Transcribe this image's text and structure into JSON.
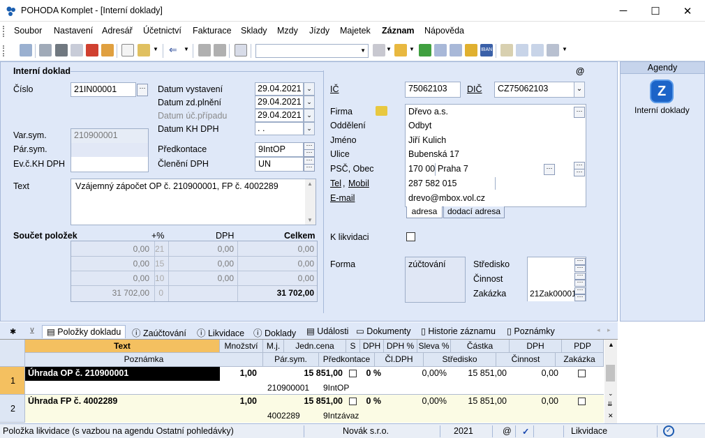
{
  "window": {
    "title": "POHODA Komplet - [Interní doklady]",
    "minimize": "─",
    "maximize": "☐",
    "close": "✕"
  },
  "menu": [
    "Soubor",
    "Nastavení",
    "Adresář",
    "Účetnictví",
    "Fakturace",
    "Sklady",
    "Mzdy",
    "Jízdy",
    "Majetek",
    "Záznam",
    "Nápověda"
  ],
  "form": {
    "section_title": "Interní doklad",
    "at_sign": "@",
    "cislo_label": "Číslo",
    "cislo_value": "21IN00001",
    "datum_vystaveni_label": "Datum vystavení",
    "datum_vystaveni": "29.04.2021",
    "datum_zdplneni_label": "Datum zd.plnění",
    "datum_zdplneni": "29.04.2021",
    "datum_ucprip_label": "Datum úč.případu",
    "datum_ucprip": "29.04.2021",
    "datum_khdph_label": "Datum KH DPH",
    "datum_khdph": "  .  .",
    "varsym_label": "Var.sym.",
    "varsym": "210900001",
    "parsym_label": "Pár.sym.",
    "evckh_label": "Ev.č.KH DPH",
    "predkontace_label": "Předkontace",
    "predkontace": "9IntOP",
    "cleneni_label": "Členění DPH",
    "cleneni": "UN",
    "text_label": "Text",
    "text_value": "Vzájemný zápočet OP č. 210900001, FP č. 4002289",
    "soucet_label": "Součet položek",
    "col_pct": "+%",
    "col_dph": "DPH",
    "col_celkem": "Celkem",
    "rows": [
      {
        "base": "0,00",
        "pct": "21",
        "dph": "0,00",
        "celkem": "0,00"
      },
      {
        "base": "0,00",
        "pct": "15",
        "dph": "0,00",
        "celkem": "0,00"
      },
      {
        "base": "0,00",
        "pct": "10",
        "dph": "0,00",
        "celkem": "0,00"
      },
      {
        "base": "31 702,00",
        "pct": "0",
        "dph": "",
        "celkem": "31 702,00"
      }
    ],
    "ic_label": "IČ",
    "ic": "75062103",
    "dic_label": "DIČ",
    "dic": "CZ75062103",
    "firma_label": "Firma",
    "firma": "Dřevo a.s.",
    "oddeleni_label": "Oddělení",
    "oddeleni": "Odbyt",
    "jmeno_label": "Jméno",
    "jmeno": "Jiří Kulich",
    "ulice_label": "Ulice",
    "ulice": "Bubenská 17",
    "psc_label": "PSČ, Obec",
    "psc": "170 00",
    "obec": "Praha 7",
    "tel_label": "Tel",
    "mobil_label": "Mobil",
    "tel": "287 582 015",
    "email_label": "E-mail",
    "email": "drevo@mbox.vol.cz",
    "tab_adresa": "adresa",
    "tab_dodaci": "dodací adresa",
    "klikvidaci_label": "K likvidaci",
    "forma_label": "Forma",
    "forma": "zúčtování",
    "stredisko_label": "Středisko",
    "cinnost_label": "Činnost",
    "zakazka_label": "Zakázka",
    "zakazka": "21Zak00001"
  },
  "agendy": {
    "title": "Agendy",
    "item": "Interní doklady"
  },
  "tabs": [
    "Položky dokladu",
    "Zaúčtování",
    "Likvidace",
    "Doklady",
    "Události",
    "Dokumenty",
    "Historie záznamu",
    "Poznámky"
  ],
  "grid": {
    "h1": [
      "Text",
      "Množství",
      "M.j.",
      "Jedn.cena",
      "S",
      "DPH",
      "DPH %",
      "Sleva %",
      "Částka",
      "DPH",
      "PDP"
    ],
    "h2": [
      "Poznámka",
      "Pár.sym.",
      "Předkontace",
      "Čl.DPH",
      "Středisko",
      "Činnost",
      "Zakázka"
    ],
    "rows": [
      {
        "num": "1",
        "text": "Úhrada OP č. 210900001",
        "mnozstvi": "1,00",
        "cena": "15 851,00",
        "dph": "0 %",
        "sleva": "0,00%",
        "castka": "15 851,00",
        "dphv": "0,00",
        "parsym": "210900001",
        "predk": "9IntOP"
      },
      {
        "num": "2",
        "text": "Úhrada FP č. 4002289",
        "mnozstvi": "1,00",
        "cena": "15 851,00",
        "dph": "0 %",
        "sleva": "0,00%",
        "castka": "15 851,00",
        "dphv": "0,00",
        "parsym": "4002289",
        "predk": "9Intzávaz"
      }
    ]
  },
  "status": {
    "msg": "Položka likvidace (s vazbou na agendu Ostatní pohledávky)",
    "company": "Novák s.r.o.",
    "year": "2021",
    "at": "@",
    "agenda": "Likvidace"
  }
}
